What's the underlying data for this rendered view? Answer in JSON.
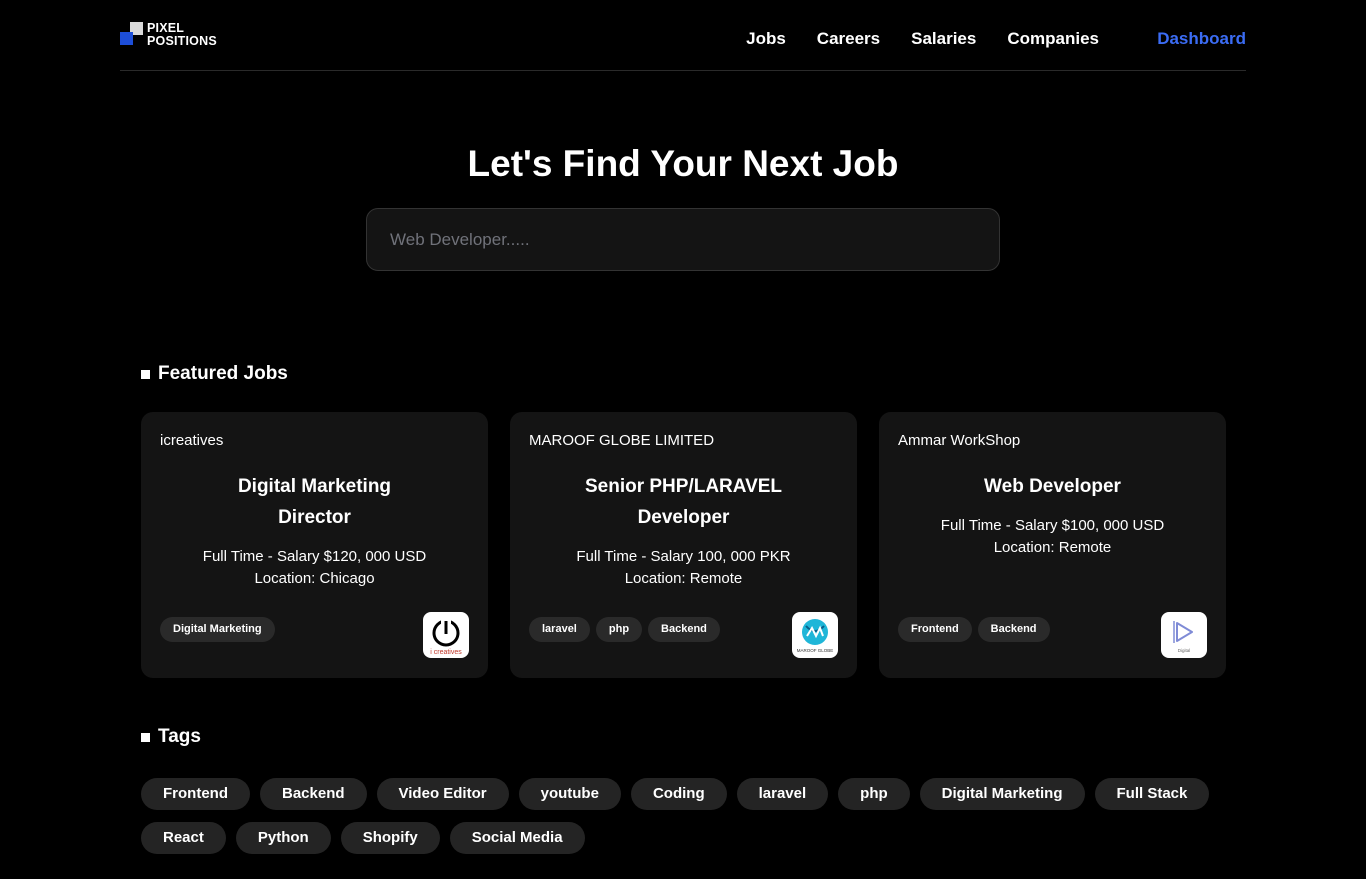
{
  "header": {
    "logo_line1": "PIXEL",
    "logo_line2": "POSITIONS",
    "nav": [
      "Jobs",
      "Careers",
      "Salaries",
      "Companies"
    ],
    "dashboard": "Dashboard"
  },
  "hero": {
    "title": "Let's Find Your Next Job",
    "search_placeholder": "Web Developer....."
  },
  "featured": {
    "heading": "Featured Jobs",
    "jobs": [
      {
        "company": "icreatives",
        "title": "Digital Marketing Director",
        "salary": "Full Time - Salary $120, 000 USD",
        "location": "Location: Chicago",
        "tags": [
          "Digital Marketing"
        ],
        "logo_icon": "power-icon",
        "logo_caption": "i creatives"
      },
      {
        "company": "MAROOF GLOBE LIMITED",
        "title": "Senior PHP/LARAVEL Developer",
        "salary": "Full Time - Salary 100, 000 PKR",
        "location": "Location: Remote",
        "tags": [
          "laravel",
          "php",
          "Backend"
        ],
        "logo_icon": "globe-icon",
        "logo_caption": "MAROOF GLOBE"
      },
      {
        "company": "Ammar WorkShop",
        "title": "Web Developer",
        "salary": "Full Time - Salary $100, 000 USD",
        "location": "Location: Remote",
        "tags": [
          "Frontend",
          "Backend"
        ],
        "logo_icon": "play-outline-icon",
        "logo_caption": "Digital"
      }
    ]
  },
  "tags": {
    "heading": "Tags",
    "row1": [
      "Frontend",
      "Backend",
      "Video Editor",
      "youtube",
      "Coding",
      "laravel",
      "php",
      "Digital Marketing",
      "Full Stack"
    ],
    "row2": [
      "React",
      "Python",
      "Shopify",
      "Social Media"
    ]
  },
  "colors": {
    "accent": "#3b6cf4",
    "background": "#000000",
    "card": "#141414",
    "pill": "#242424"
  }
}
